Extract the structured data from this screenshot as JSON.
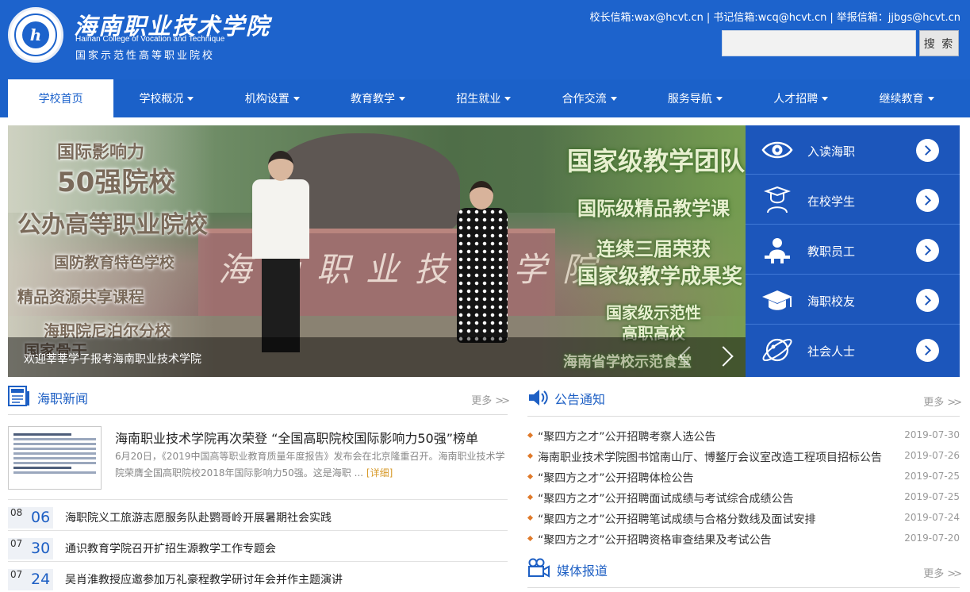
{
  "header": {
    "school_cn": "海南职业技术学院",
    "school_en": "Hainan College of Vocation and Technique",
    "slogan": "国家示范性高等职业院校",
    "mail_president": "校长信箱:wax@hcvt.cn",
    "mail_secretary": "书记信箱:wcq@hcvt.cn",
    "mail_report": "举报信箱：jjbgs@hcvt.cn",
    "search_placeholder": "",
    "search_button": "搜 索"
  },
  "nav": [
    {
      "label": "学校首页",
      "active": true,
      "dropdown": false
    },
    {
      "label": "学校概况",
      "dropdown": true
    },
    {
      "label": "机构设置",
      "dropdown": true
    },
    {
      "label": "教育教学",
      "dropdown": true
    },
    {
      "label": "招生就业",
      "dropdown": true
    },
    {
      "label": "合作交流",
      "dropdown": true
    },
    {
      "label": "服务导航",
      "dropdown": true
    },
    {
      "label": "人才招聘",
      "dropdown": true
    },
    {
      "label": "继续教育",
      "dropdown": true
    }
  ],
  "banner": {
    "left_tags": [
      "国际影响力",
      "50强院校",
      "公办高等职业院校",
      "国防教育特色学校",
      "精品资源共享课程",
      "海职院尼泊尔分校",
      "国家骨干"
    ],
    "right_tags": [
      "国家级教学团队",
      "国际级精品教学课",
      "连续三届荣获",
      "国家级教学成果奖",
      "国家级示范性",
      "高职高校",
      "海南省学校示范食堂"
    ],
    "wall_text": "海南职业技术学院",
    "caption": "欢迎莘莘学子报考海南职业技术学院"
  },
  "quick_links": [
    {
      "label": "入读海职",
      "icon": "eye-icon"
    },
    {
      "label": "在校学生",
      "icon": "graduate-student-icon"
    },
    {
      "label": "教职员工",
      "icon": "teacher-icon"
    },
    {
      "label": "海职校友",
      "icon": "mortarboard-icon"
    },
    {
      "label": "社会人士",
      "icon": "globe-icon"
    }
  ],
  "news": {
    "title": "海职新闻",
    "more": "更多",
    "featured": {
      "headline": "海南职业技术学院再次荣登 “全国高职院校国际影响力50强”榜单",
      "summary": "6月20日，《2019中国高等职业教育质量年度报告》发布会在北京隆重召开。海南职业技术学院荣膺全国高职院校2018年国际影响力50强。这是海职 ...",
      "detail": "[详细]"
    },
    "items": [
      {
        "month": "08",
        "day": "06",
        "title": "海职院义工旅游志愿服务队赴鹦哥岭开展暑期社会实践"
      },
      {
        "month": "07",
        "day": "30",
        "title": "通识教育学院召开扩招生源教学工作专题会"
      },
      {
        "month": "07",
        "day": "24",
        "title": "吴肖淮教授应邀参加万礼豪程教学研讨年会并作主题演讲"
      }
    ]
  },
  "notices": {
    "title": "公告通知",
    "more": "更多",
    "items": [
      {
        "title": "“聚四方之才”公开招聘考察人选公告",
        "date": "2019-07-30"
      },
      {
        "title": "海南职业技术学院图书馆南山厅、博鳌厅会议室改造工程项目招标公告",
        "date": "2019-07-26"
      },
      {
        "title": "“聚四方之才”公开招聘体检公告",
        "date": "2019-07-25"
      },
      {
        "title": "“聚四方之才”公开招聘面试成绩与考试综合成绩公告",
        "date": "2019-07-25"
      },
      {
        "title": "“聚四方之才”公开招聘笔试成绩与合格分数线及面试安排",
        "date": "2019-07-24"
      },
      {
        "title": "“聚四方之才”公开招聘资格审查结果及考试公告",
        "date": "2019-07-20"
      }
    ]
  },
  "media": {
    "title": "媒体报道",
    "more": "更多"
  },
  "colors": {
    "brand_blue": "#1d63cc",
    "quick_blue": "#1c56bb",
    "notice_dot": "#e07a2a",
    "detail_link": "#d79a2a"
  }
}
